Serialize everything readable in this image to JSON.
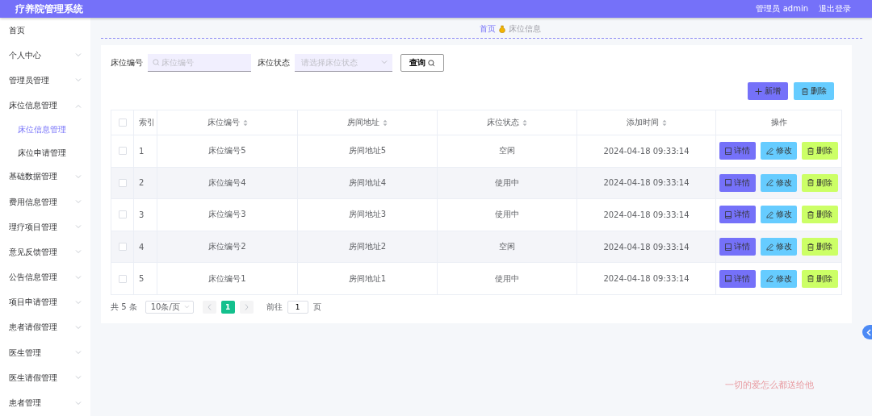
{
  "header": {
    "title": "疗养院管理系统",
    "user": "管理员 admin",
    "logout": "退出登录"
  },
  "sidebar": {
    "items": [
      {
        "label": "首页",
        "kind": "link"
      },
      {
        "label": "个人中心",
        "kind": "menu",
        "expanded": false
      },
      {
        "label": "管理员管理",
        "kind": "menu",
        "expanded": false
      },
      {
        "label": "床位信息管理",
        "kind": "menu",
        "expanded": true,
        "children": [
          {
            "label": "床位信息管理",
            "selected": true
          },
          {
            "label": "床位申请管理",
            "selected": false
          }
        ]
      },
      {
        "label": "基础数据管理",
        "kind": "menu",
        "expanded": false
      },
      {
        "label": "费用信息管理",
        "kind": "menu",
        "expanded": false
      },
      {
        "label": "理疗项目管理",
        "kind": "menu",
        "expanded": false
      },
      {
        "label": "意见反馈管理",
        "kind": "menu",
        "expanded": false
      },
      {
        "label": "公告信息管理",
        "kind": "menu",
        "expanded": false
      },
      {
        "label": "项目申请管理",
        "kind": "menu",
        "expanded": false
      },
      {
        "label": "患者请假管理",
        "kind": "menu",
        "expanded": false
      },
      {
        "label": "医生管理",
        "kind": "menu",
        "expanded": false
      },
      {
        "label": "医生请假管理",
        "kind": "menu",
        "expanded": false
      },
      {
        "label": "患者管理",
        "kind": "menu",
        "expanded": false
      }
    ]
  },
  "breadcrumb": [
    "首页",
    "床位信息"
  ],
  "filters": [
    {
      "label": "床位编号",
      "kind": "text",
      "placeholder": "床位编号"
    },
    {
      "label": "床位状态",
      "kind": "select",
      "placeholder": "请选择床位状态"
    }
  ],
  "search_button": "查询",
  "toolbar": [
    {
      "label": "新增",
      "kind": "add"
    },
    {
      "label": "删除",
      "kind": "delete"
    }
  ],
  "table": {
    "select_all_checked": false,
    "columns": [
      {
        "label": "索引",
        "sortable": false
      },
      {
        "label": "床位编号",
        "sortable": true
      },
      {
        "label": "房间地址",
        "sortable": true
      },
      {
        "label": "床位状态",
        "sortable": true
      },
      {
        "label": "添加时间",
        "sortable": true
      },
      {
        "label": "操作",
        "sortable": false
      }
    ],
    "rows": [
      {
        "checked": false,
        "index": "1",
        "bed": "床位编号5",
        "room": "房间地址5",
        "status": "空闲",
        "time": "2024-04-18 09:33:14",
        "actions": [
          {
            "label": "详情",
            "kind": "detail"
          },
          {
            "label": "修改",
            "kind": "edit"
          },
          {
            "label": "删除",
            "kind": "delete"
          }
        ]
      },
      {
        "checked": false,
        "index": "2",
        "bed": "床位编号4",
        "room": "房间地址4",
        "status": "使用中",
        "time": "2024-04-18 09:33:14",
        "actions": [
          {
            "label": "详情",
            "kind": "detail"
          },
          {
            "label": "修改",
            "kind": "edit"
          },
          {
            "label": "删除",
            "kind": "delete"
          }
        ]
      },
      {
        "checked": false,
        "index": "3",
        "bed": "床位编号3",
        "room": "房间地址3",
        "status": "使用中",
        "time": "2024-04-18 09:33:14",
        "actions": [
          {
            "label": "详情",
            "kind": "detail"
          },
          {
            "label": "修改",
            "kind": "edit"
          },
          {
            "label": "删除",
            "kind": "delete"
          }
        ]
      },
      {
        "checked": false,
        "index": "4",
        "bed": "床位编号2",
        "room": "房间地址2",
        "status": "空闲",
        "time": "2024-04-18 09:33:14",
        "actions": [
          {
            "label": "详情",
            "kind": "detail"
          },
          {
            "label": "修改",
            "kind": "edit"
          },
          {
            "label": "删除",
            "kind": "delete"
          }
        ]
      },
      {
        "checked": false,
        "index": "5",
        "bed": "床位编号1",
        "room": "房间地址1",
        "status": "使用中",
        "time": "2024-04-18 09:33:14",
        "actions": [
          {
            "label": "详情",
            "kind": "detail"
          },
          {
            "label": "修改",
            "kind": "edit"
          },
          {
            "label": "删除",
            "kind": "delete"
          }
        ]
      }
    ]
  },
  "pagination": {
    "total": "共 5 条",
    "page_size": "10条/页",
    "pages": [
      {
        "label": "1",
        "selected": true
      }
    ],
    "goto_label": "前往",
    "goto_value": "1",
    "goto_suffix": "页"
  },
  "slogan": "一切的爱怎么都送给他"
}
